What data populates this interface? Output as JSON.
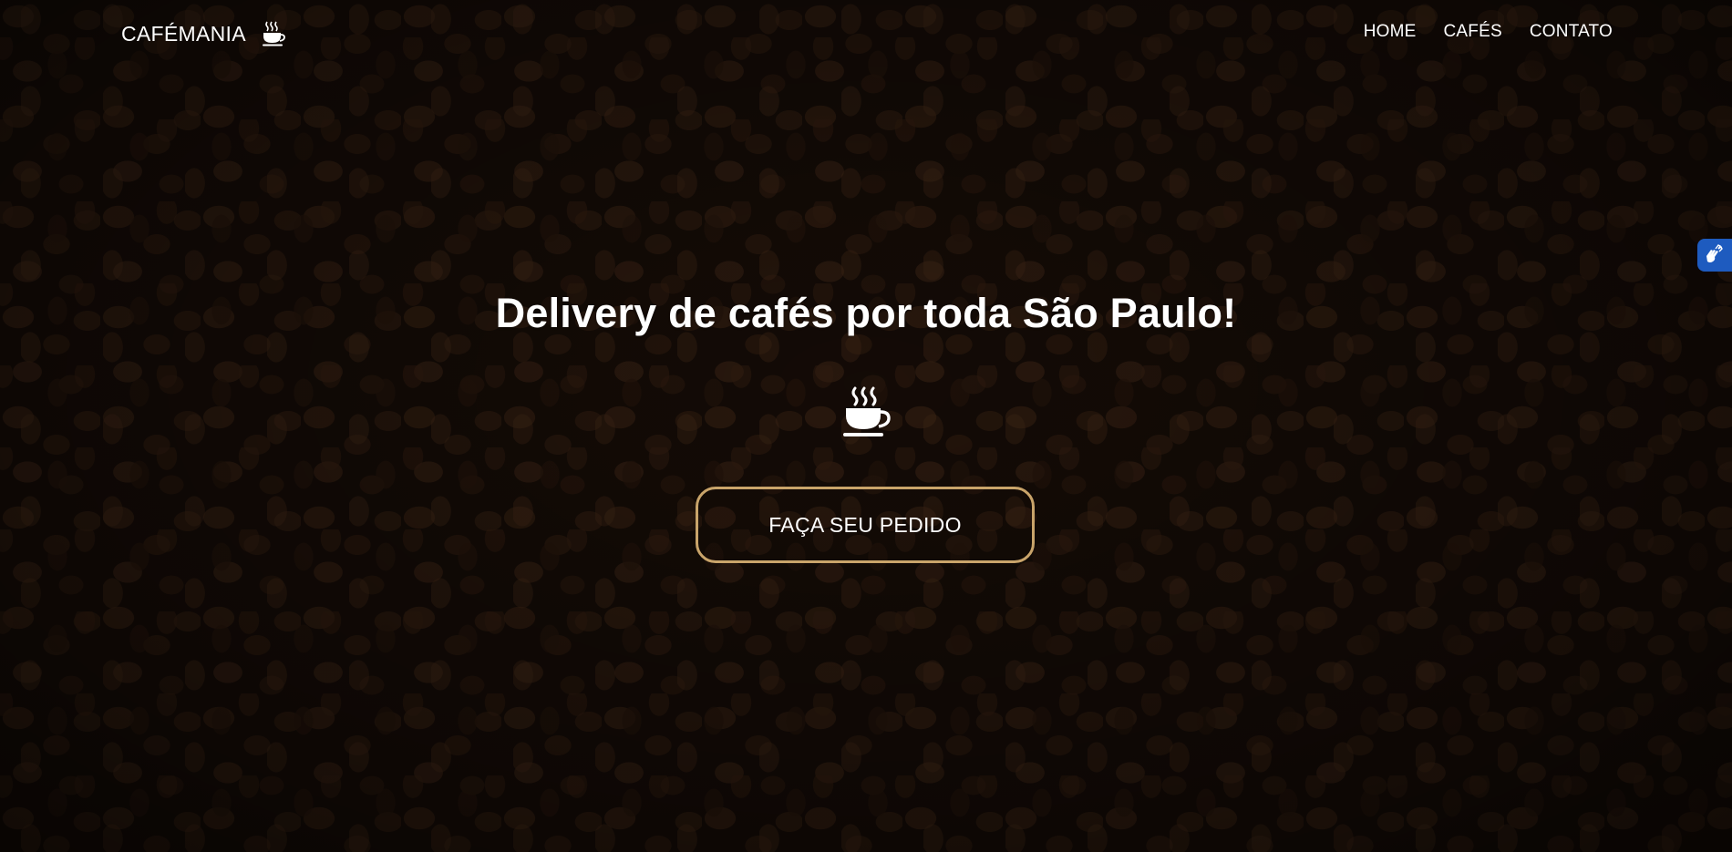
{
  "navbar": {
    "brand": "CAFÉMANIA",
    "brand_icon": "coffee-cup-icon",
    "links": [
      {
        "label": "HOME"
      },
      {
        "label": "CAFÉS"
      },
      {
        "label": "CONTATO"
      }
    ]
  },
  "hero": {
    "title": "Delivery de cafés por toda São Paulo!",
    "icon": "coffee-cup-icon",
    "cta_label": "FAÇA SEU PEDIDO",
    "background": "coffee-beans-image"
  },
  "accessibility_widget": {
    "icon": "sign-language-hands-icon"
  },
  "colors": {
    "cta_border": "#c9a46a",
    "text": "#ffffff",
    "a11y_tab": "#1e5bbf"
  }
}
